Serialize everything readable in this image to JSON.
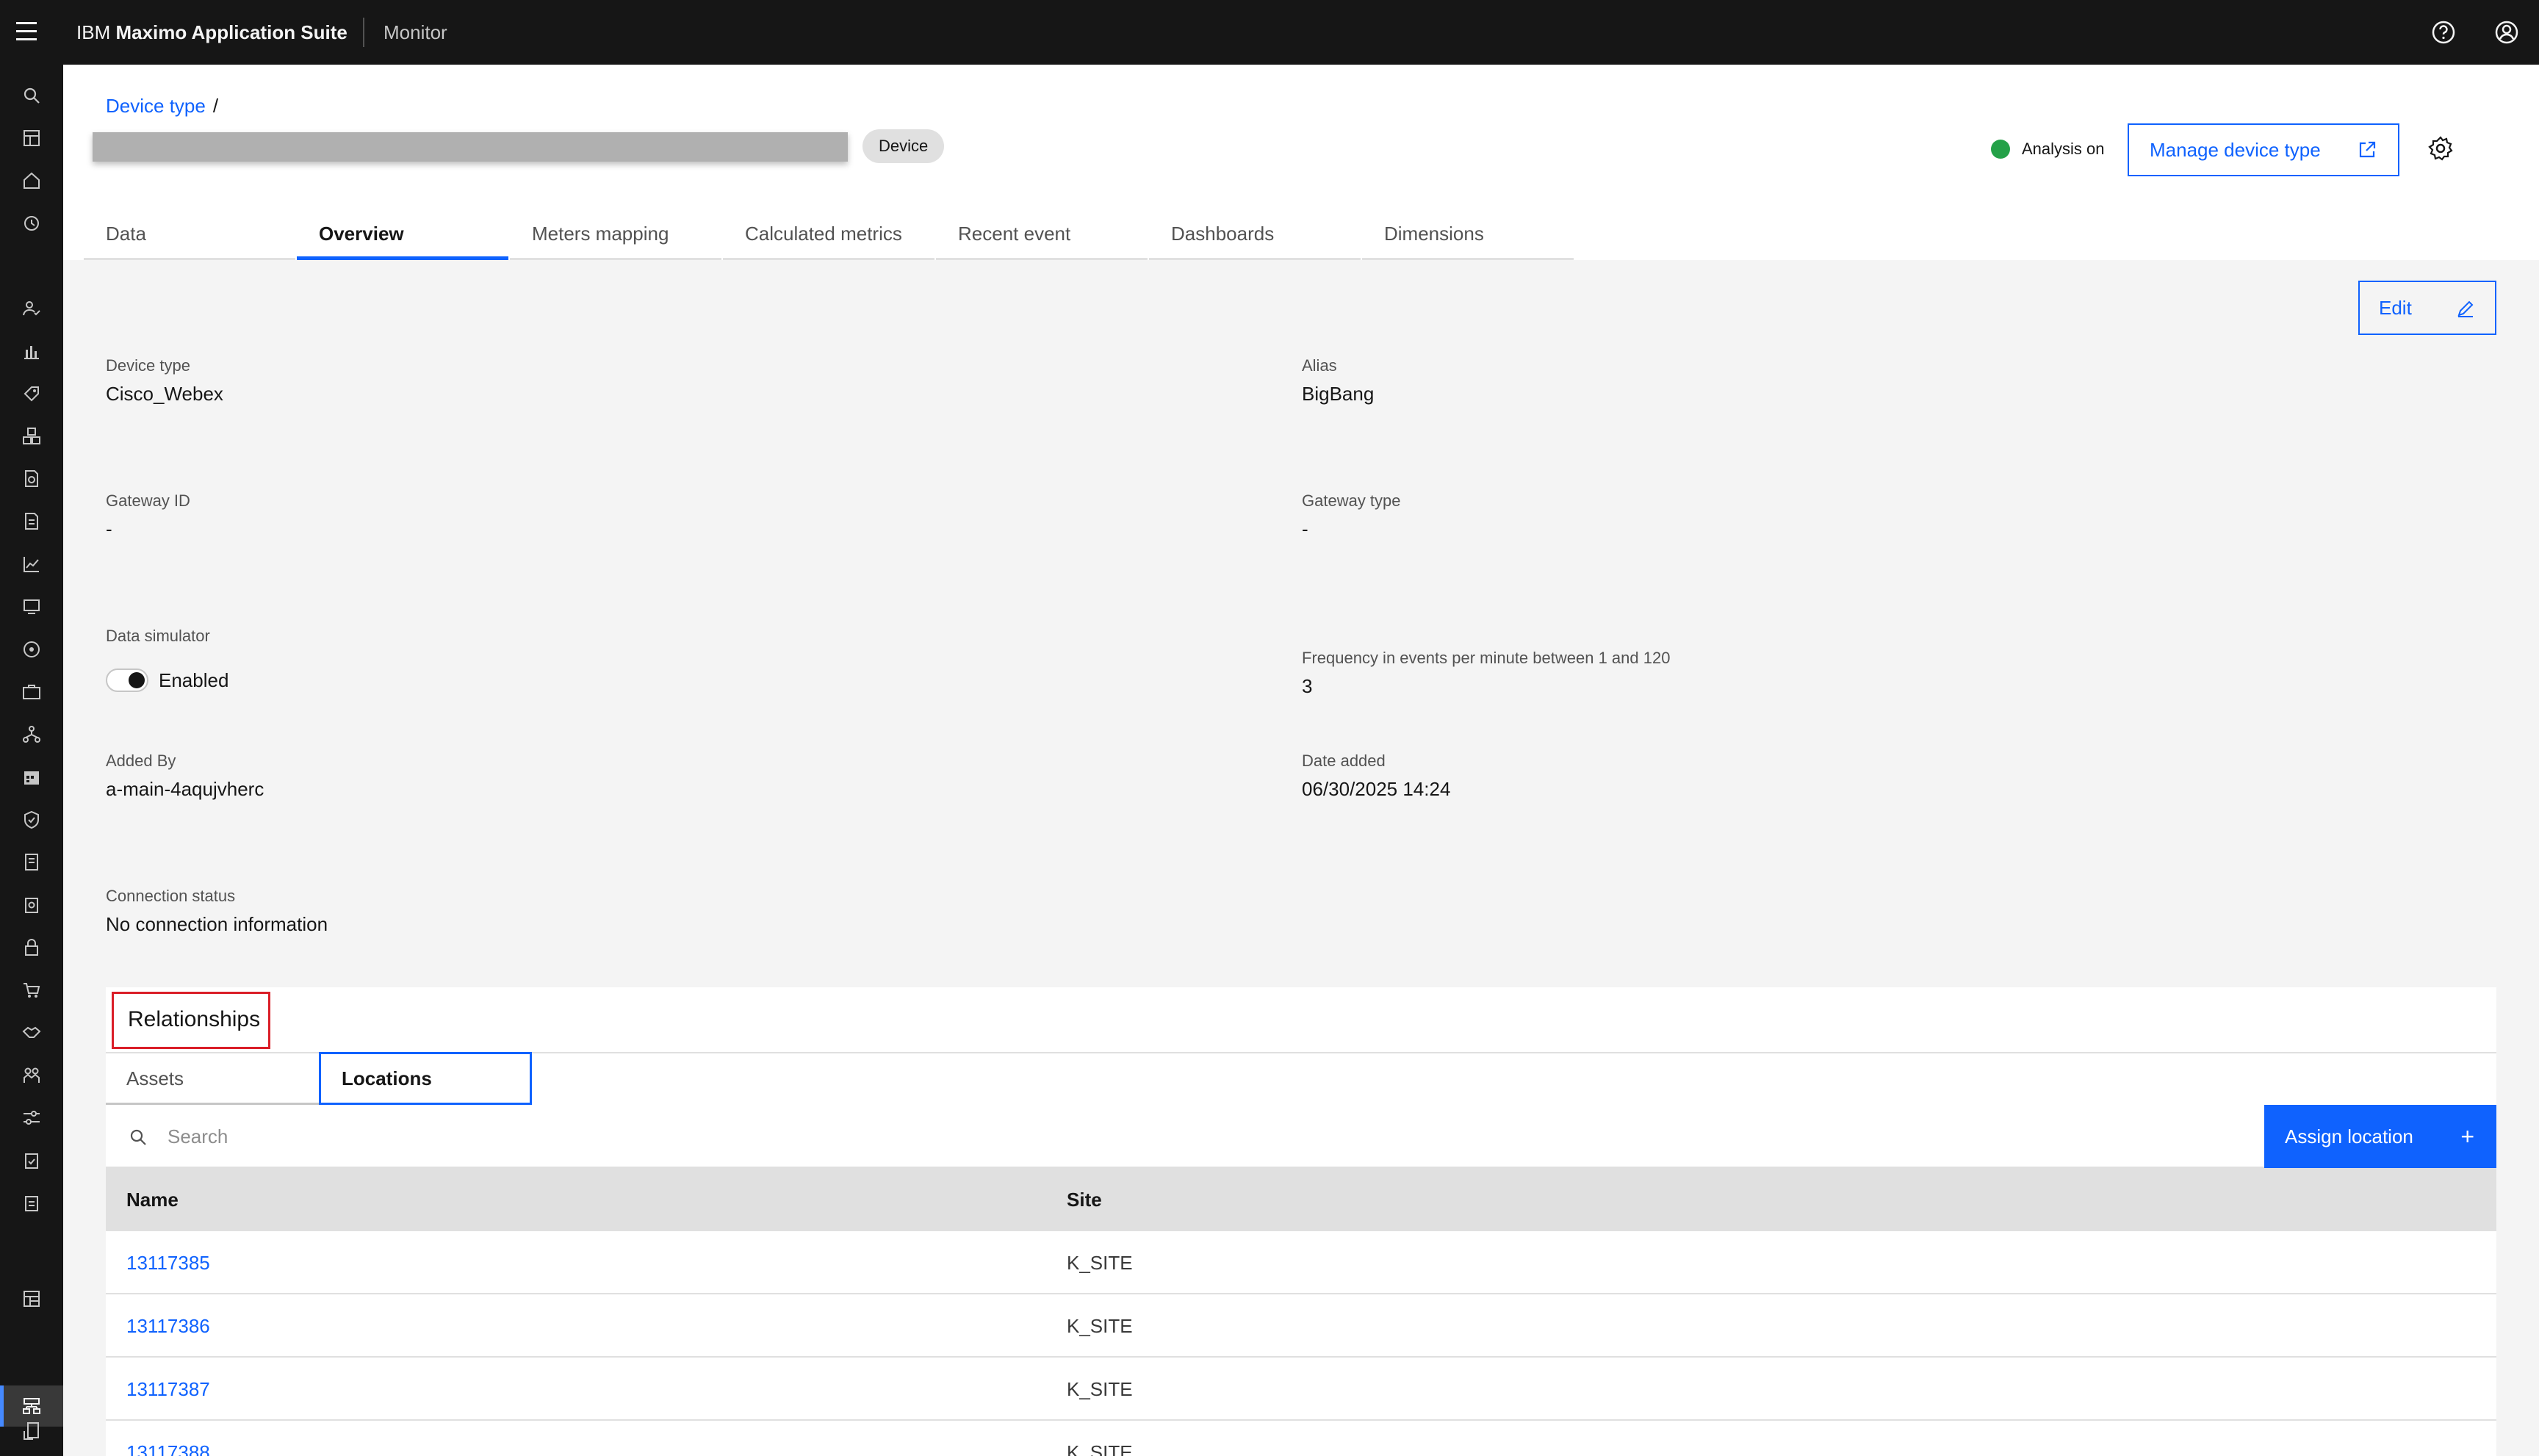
{
  "header": {
    "brand_prefix": "IBM",
    "brand_name": "Maximo Application Suite",
    "app_name": "Monitor"
  },
  "page": {
    "breadcrumb_link": "Device type",
    "breadcrumb_sep": "/",
    "tag": "Device",
    "analysis_status": "Analysis on",
    "manage_button": "Manage device type"
  },
  "tabs": [
    "Data",
    "Overview",
    "Meters mapping",
    "Calculated metrics",
    "Recent event",
    "Dashboards",
    "Dimensions"
  ],
  "details": {
    "edit_label": "Edit",
    "device_type_label": "Device type",
    "device_type_value": "Cisco_Webex",
    "alias_label": "Alias",
    "alias_value": "BigBang",
    "gateway_id_label": "Gateway ID",
    "gateway_id_value": "-",
    "gateway_type_label": "Gateway type",
    "gateway_type_value": "-",
    "simulator_label": "Data simulator",
    "simulator_value": "Enabled",
    "frequency_label": "Frequency in events per minute between 1 and 120",
    "frequency_value": "3",
    "added_by_label": "Added By",
    "added_by_value": "a-main-4aqujvherc",
    "date_added_label": "Date added",
    "date_added_value": "06/30/2025 14:24",
    "connection_label": "Connection status",
    "connection_value": "No connection information"
  },
  "relationships": {
    "title": "Relationships",
    "tabs": [
      "Assets",
      "Locations"
    ],
    "search_placeholder": "Search",
    "assign_button": "Assign location",
    "assign_plus": "+",
    "columns": [
      "Name",
      "Site"
    ],
    "rows": [
      {
        "name": "13117385",
        "site": "K_SITE"
      },
      {
        "name": "13117386",
        "site": "K_SITE"
      },
      {
        "name": "13117387",
        "site": "K_SITE"
      },
      {
        "name": "13117388",
        "site": "K_SITE"
      }
    ]
  },
  "colors": {
    "primary": "#0f62fe",
    "status_green": "#24a148",
    "highlight_red": "#da1e28",
    "shell": "#161616"
  }
}
